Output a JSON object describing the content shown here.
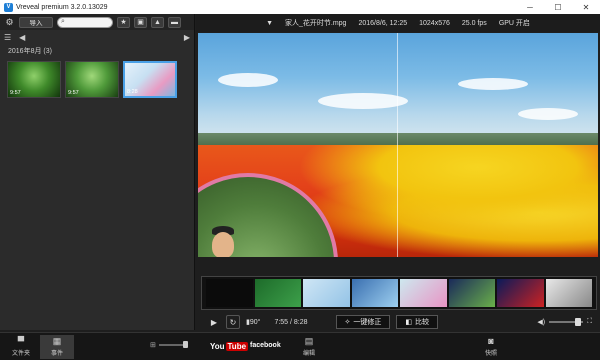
{
  "window": {
    "title": "Vreveal premium 3.2.0.13029",
    "minimize": "─",
    "maximize": "☐",
    "close": "✕"
  },
  "library": {
    "import_label": "导入",
    "search_placeholder": "",
    "nav_prev": "◀",
    "nav_next": "▶",
    "date_group": "2016年8月 (3)",
    "thumbnails": [
      {
        "duration": "9:57"
      },
      {
        "duration": "9:57"
      },
      {
        "duration": "8:28"
      }
    ]
  },
  "video_info": {
    "filename": "家人_花开时节.mpg",
    "datetime": "2016/8/6, 12:25",
    "resolution": "1024x576",
    "fps": "25.0 fps",
    "gpu": "GPU 开启"
  },
  "playback": {
    "rotation": "90°",
    "timecode": "7:55 / 8:28",
    "enhance_label": "一键修正",
    "compare_label": "比较"
  },
  "bottom_bar": {
    "folder_label": "文件夹",
    "events_label": "事件",
    "youtube_text": "You",
    "youtube_tube": "Tube",
    "facebook": "facebook",
    "edit_label": "编辑",
    "snapshot_label": "快照"
  },
  "colors": {
    "accent": "#4aa0e6",
    "panel": "#2b2b2b",
    "background": "#1e1e1e"
  }
}
